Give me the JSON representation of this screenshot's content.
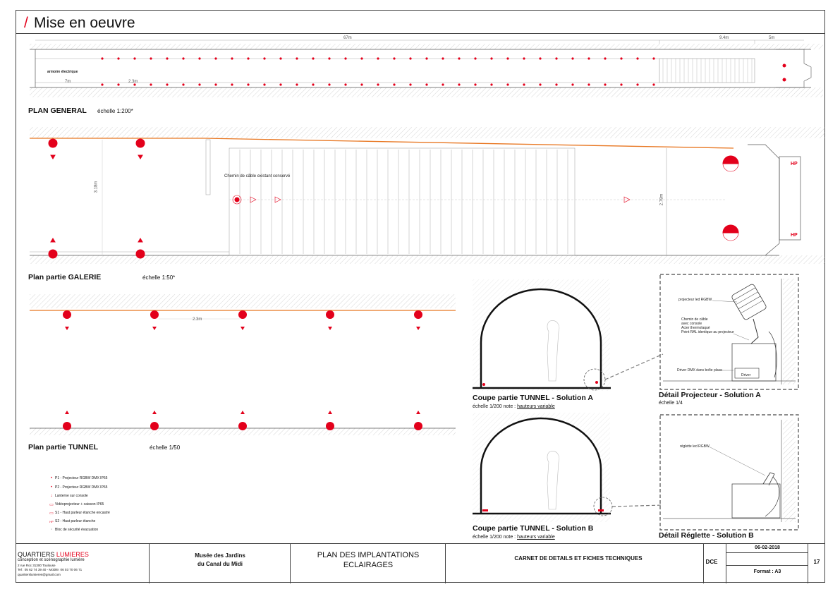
{
  "header": {
    "slash": "/",
    "title": "Mise en oeuvre"
  },
  "plan_general": {
    "label": "PLAN GENERAL",
    "scale": "échelle 1:200*",
    "dim_total": "67m",
    "dim_mid": "9.4m",
    "dim_right": "5m",
    "dim_left": "7m",
    "dim_spacing": "2.3m",
    "armoire": "armoire électrique"
  },
  "plan_galerie": {
    "label": "Plan partie GALERIE",
    "scale": "échelle 1:50*",
    "cable_note": "Chemin de câble existant conservé",
    "dim_height_left": "3.18m",
    "dim_height_right": "2.78m",
    "hp1": "HP",
    "hp2": "HP"
  },
  "plan_tunnel": {
    "label": "Plan partie TUNNEL",
    "scale": "échelle 1/50",
    "dim_spacing": "2.3m"
  },
  "coupe_a": {
    "label": "Coupe partie TUNNEL  - Solution A",
    "scale_prefix": "échelle 1/200 note : ",
    "scale_link": "hauteurs variable"
  },
  "coupe_b": {
    "label": "Coupe partie TUNNEL  - Solution B",
    "scale_prefix": "échelle 1/200 note : ",
    "scale_link": "hauteurs variable"
  },
  "detail_a": {
    "label": "Détail Projecteur - Solution A",
    "scale": "échelle 1/4",
    "note_projector": "projecteur led RGBW",
    "note_cable_1": "Chemin de câble",
    "note_cable_2": "avec console",
    "note_cable_3": "Acier thermolaqué",
    "note_cable_4": "Peint RAL identique au projecteur",
    "note_driver": "Driver DMX dans boîte placo",
    "driver_box": "Driver"
  },
  "detail_b": {
    "label": "Détail Réglette - Solution B",
    "note_reglette": "réglette led RGBW"
  },
  "legend": [
    {
      "symbol": "•",
      "text": "P1 - Projecteur RGBW DMX  IP65"
    },
    {
      "symbol": "•",
      "text": "P2 - Projecteur RGBW DMX  IP65"
    },
    {
      "symbol": "↓",
      "text": "Lanterne sur console"
    },
    {
      "symbol": "▭",
      "text": "Vidéoprojecteur + caisson IP65"
    },
    {
      "symbol": "▭",
      "text": "S1 - Haut parleur étanche encastré"
    },
    {
      "symbol": "HP",
      "text": "S2 - Haut parleur étanche"
    },
    {
      "symbol": "▫",
      "text": "Bloc de sécurité évacuation"
    }
  ],
  "title_block": {
    "company_1": "QUARTIERS ",
    "company_2": "LUMIERES",
    "tagline": "conception et scénographie lumière",
    "address": "2 rue Roc 31300 Toulouse",
    "phone": "Tel : 05 62 74 39 40 - Mobile: 06 03 70 06 71",
    "email": "quartierslumieres@gmail.com",
    "project_1": "Musée des Jardins",
    "project_2": "du Canal du Midi",
    "drawing_1": "PLAN DES IMPLANTATIONS",
    "drawing_2": "ECLAIRAGES",
    "carnet": "CARNET DE DETAILS ET FICHES TECHNIQUES",
    "phase": "DCE",
    "date": "06-02-2018",
    "format": "Format : A3",
    "page": "17"
  },
  "colors": {
    "accent": "#e3001b",
    "cable": "#e87722",
    "line": "#444444"
  }
}
